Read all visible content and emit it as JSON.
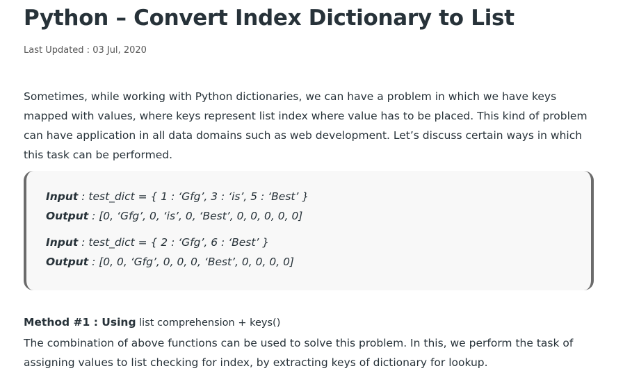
{
  "article": {
    "title": "Python – Convert Index Dictionary to List",
    "last_updated": "Last Updated : 03 Jul, 2020",
    "intro": "Sometimes, while working with Python dictionaries, we can have a problem in which we have keys mapped with values, where keys represent list index where value has to be placed. This kind of problem can have application in all data domains such as web development. Let’s discuss certain ways in which this task can be performed.",
    "examples": [
      {
        "input_label": "Input",
        "input_value": " : test_dict = { 1 : ‘Gfg’, 3 : ‘is’, 5 : ‘Best’ }",
        "output_label": "Output",
        "output_value": " : [0, ‘Gfg’, 0, ‘is’, 0, ‘Best’, 0, 0, 0, 0, 0]"
      },
      {
        "input_label": "Input",
        "input_value": " : test_dict = { 2 : ‘Gfg’, 6 : ‘Best’ }",
        "output_label": "Output",
        "output_value": " : [0, 0, ‘Gfg’, 0, 0, 0, ‘Best’, 0, 0, 0, 0]"
      }
    ],
    "method_heading": "Method #1 : Using",
    "method_detail": " list comprehension + keys()",
    "method_text": "The combination of above functions can be used to solve this problem. In this, we perform the task of assigning values to list checking for index, by extracting keys of dictionary for lookup."
  }
}
